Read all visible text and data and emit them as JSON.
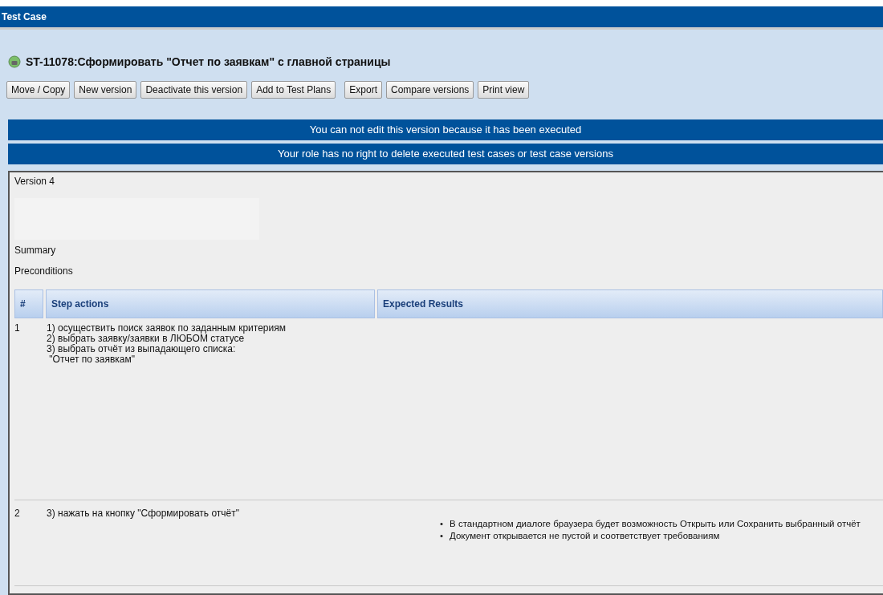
{
  "window": {
    "title": "Test Case"
  },
  "heading": "ST-11078:Сформировать \"Отчет по заявкам\" с главной страницы",
  "buttons": [
    "Move / Copy",
    "New version",
    "Deactivate this version",
    "Add to Test Plans",
    "Export",
    "Compare versions",
    "Print view"
  ],
  "messages": [
    "You can not edit this version because it has been executed",
    "Your role has no right to delete executed test cases or test case versions"
  ],
  "version": "Version 4",
  "summary_label": "Summary",
  "preconditions_label": "Preconditions",
  "table": {
    "columns": [
      "#",
      "Step actions",
      "Expected Results"
    ],
    "rows": [
      {
        "number": "1",
        "actions": [
          "1) осуществить поиск заявок по заданным критериям",
          "2) выбрать заявку/заявки в ЛЮБОМ статусе",
          "3) выбрать отчёт из выпадающего списка:",
          " \"Отчет по заявкам\""
        ],
        "expected": []
      },
      {
        "number": "2",
        "actions": [
          "3) нажать на кнопку \"Сформировать отчёт\""
        ],
        "bullet": "•",
        "expected": [
          "В стандартном диалоге браузера будет возможность Открыть или Сохранить выбранный отчёт",
          "Документ открывается не пустой и соответствует требованиям"
        ]
      }
    ]
  }
}
